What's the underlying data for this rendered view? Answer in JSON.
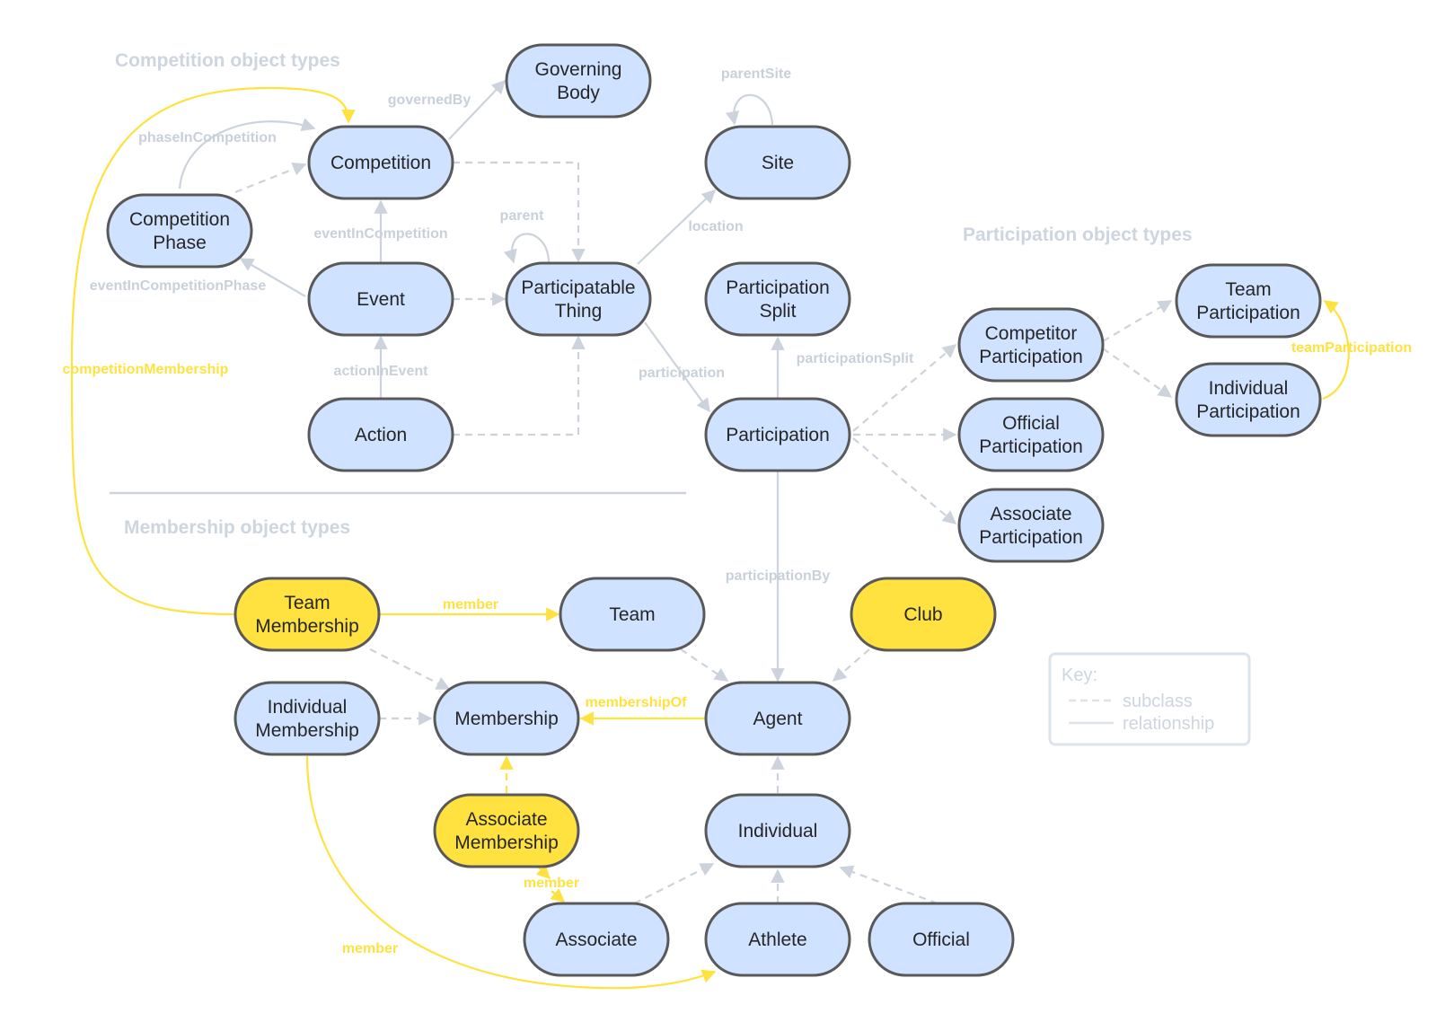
{
  "sections": {
    "competition": "Competition object types",
    "participation": "Participation object types",
    "membership": "Membership object types"
  },
  "nodes": {
    "governing_body": {
      "lines": [
        "Governing",
        "Body"
      ],
      "color": "blue"
    },
    "competition": {
      "lines": [
        "Competition"
      ],
      "color": "blue"
    },
    "competition_phase": {
      "lines": [
        "Competition",
        "Phase"
      ],
      "color": "blue"
    },
    "site": {
      "lines": [
        "Site"
      ],
      "color": "blue"
    },
    "event": {
      "lines": [
        "Event"
      ],
      "color": "blue"
    },
    "participatable_thing": {
      "lines": [
        "Participatable",
        "Thing"
      ],
      "color": "blue"
    },
    "action": {
      "lines": [
        "Action"
      ],
      "color": "blue"
    },
    "participation_split": {
      "lines": [
        "Participation",
        "Split"
      ],
      "color": "blue"
    },
    "participation": {
      "lines": [
        "Participation"
      ],
      "color": "blue"
    },
    "competitor_participation": {
      "lines": [
        "Competitor",
        "Participation"
      ],
      "color": "blue"
    },
    "official_participation": {
      "lines": [
        "Official",
        "Participation"
      ],
      "color": "blue"
    },
    "associate_participation": {
      "lines": [
        "Associate",
        "Participation"
      ],
      "color": "blue"
    },
    "team_participation": {
      "lines": [
        "Team",
        "Participation"
      ],
      "color": "blue"
    },
    "individual_participation": {
      "lines": [
        "Individual",
        "Participation"
      ],
      "color": "blue"
    },
    "team_membership": {
      "lines": [
        "Team",
        "Membership"
      ],
      "color": "yellow"
    },
    "team": {
      "lines": [
        "Team"
      ],
      "color": "blue"
    },
    "club": {
      "lines": [
        "Club"
      ],
      "color": "yellow"
    },
    "individual_membership": {
      "lines": [
        "Individual",
        "Membership"
      ],
      "color": "blue"
    },
    "membership": {
      "lines": [
        "Membership"
      ],
      "color": "blue"
    },
    "agent": {
      "lines": [
        "Agent"
      ],
      "color": "blue"
    },
    "associate_membership": {
      "lines": [
        "Associate",
        "Membership"
      ],
      "color": "yellow"
    },
    "individual": {
      "lines": [
        "Individual"
      ],
      "color": "blue"
    },
    "associate": {
      "lines": [
        "Associate"
      ],
      "color": "blue"
    },
    "athlete": {
      "lines": [
        "Athlete"
      ],
      "color": "blue"
    },
    "official": {
      "lines": [
        "Official"
      ],
      "color": "blue"
    }
  },
  "edge_labels": {
    "governed_by": "governedBy",
    "phase_in_competition": "phaseInCompetition",
    "event_in_competition": "eventInCompetition",
    "event_in_competition_phase": "eventInCompetitionPhase",
    "action_in_event": "actionInEvent",
    "parent": "parent",
    "parent_site": "parentSite",
    "location": "location",
    "participation": "participation",
    "participation_split": "participationSplit",
    "participation_by": "participationBy",
    "team_participation": "teamParticipation",
    "competition_membership": "competitionMembership",
    "member_team": "member",
    "membership_of": "membershipOf",
    "member_associate": "member",
    "member_individual": "member"
  },
  "key": {
    "title": "Key:",
    "subclass": "subclass",
    "relationship": "relationship"
  },
  "colors": {
    "node_blue": "#cfe2ff",
    "node_yellow": "#ffe140",
    "edge_grey": "#ccd3dc",
    "edge_yellow": "#ffe140"
  }
}
